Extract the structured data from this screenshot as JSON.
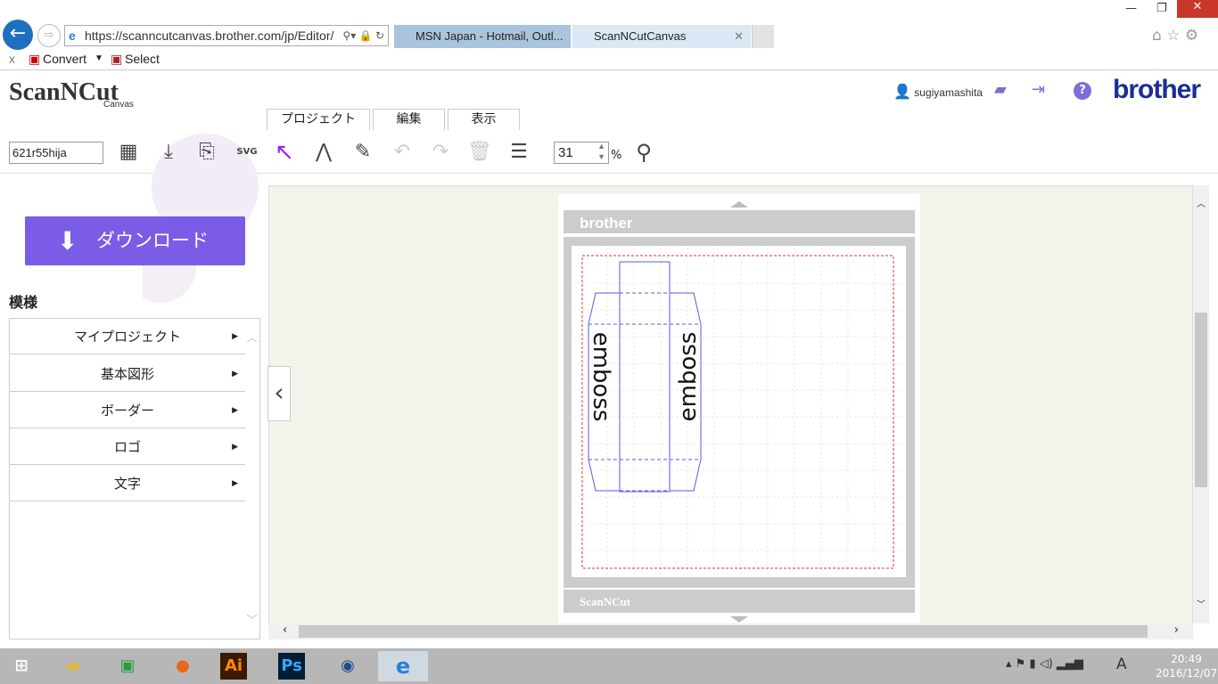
{
  "browser": {
    "url": "https://scanncutcanvas.brother.com/jp/Editor/",
    "tabs": [
      {
        "label": "MSN Japan - Hotmail, Outl..."
      },
      {
        "label": "ScanNCutCanvas"
      }
    ],
    "favorites": {
      "close": "x",
      "convert": "Convert",
      "select": "Select"
    }
  },
  "app": {
    "logo": "ScanNCut",
    "logo_sub": "Canvas",
    "username": "sugiyamashita",
    "brand": "brother",
    "menu_tabs": [
      "プロジェクト",
      "編集",
      "表示"
    ],
    "project_name": "621r55hija",
    "zoom_value": "31",
    "zoom_unit": "%",
    "download_label": "ダウンロード",
    "section_title": "模様",
    "categories": [
      "マイプロジェクト",
      "基本図形",
      "ボーダー",
      "ロゴ",
      "文字"
    ],
    "mat": {
      "top_brand": "brother",
      "bottom_brand": "ScanNCut",
      "shape_text": [
        "emboss",
        "emboss"
      ]
    },
    "accent_color": "#7b5ce6",
    "brand_color": "#1c2d96"
  },
  "taskbar": {
    "time": "20:49",
    "date": "2016/12/07",
    "ime": "A",
    "apps": [
      "file-explorer",
      "store",
      "firefox",
      "Ai",
      "Ps",
      "app",
      "internet-explorer"
    ]
  }
}
